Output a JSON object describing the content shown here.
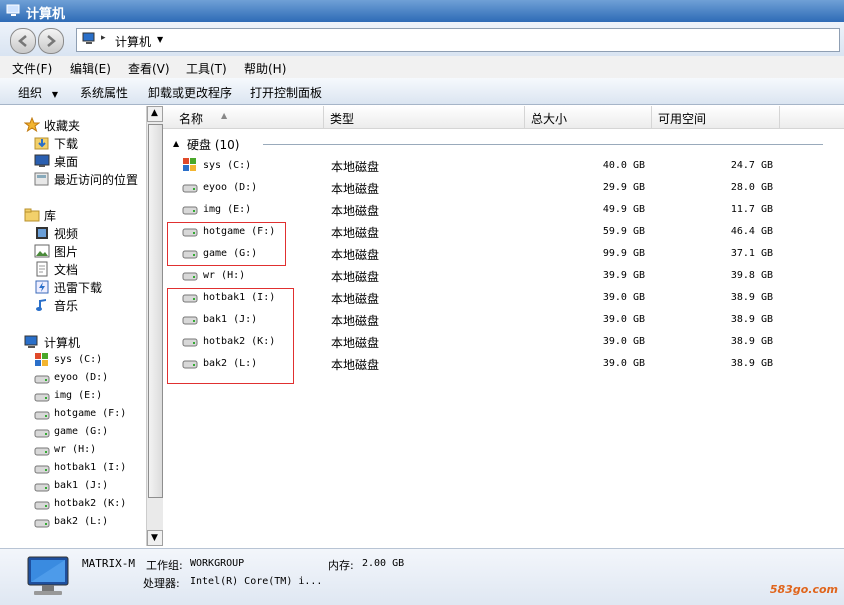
{
  "window": {
    "title": "计算机"
  },
  "address": {
    "crumb": "计算机"
  },
  "menu": [
    "文件(F)",
    "编辑(E)",
    "查看(V)",
    "工具(T)",
    "帮助(H)"
  ],
  "commands": [
    "组织",
    "系统属性",
    "卸载或更改程序",
    "打开控制面板"
  ],
  "nav": {
    "favorites": {
      "label": "收藏夹",
      "items": [
        "下载",
        "桌面",
        "最近访问的位置"
      ]
    },
    "libraries": {
      "label": "库",
      "items": [
        "视频",
        "图片",
        "文档",
        "迅雷下载",
        "音乐"
      ]
    },
    "computer": {
      "label": "计算机",
      "drives": [
        "sys (C:)",
        "eyoo (D:)",
        "img (E:)",
        "hotgame (F:)",
        "game (G:)",
        "wr (H:)",
        "hotbak1 (I:)",
        "bak1 (J:)",
        "hotbak2 (K:)",
        "bak2 (L:)"
      ]
    }
  },
  "columns": [
    "名称",
    "类型",
    "总大小",
    "可用空间"
  ],
  "group": {
    "label": "硬盘 (10)"
  },
  "drives": [
    {
      "name": "sys (C:)",
      "type": "本地磁盘",
      "total": "40.0 GB",
      "free": "24.7 GB",
      "icon": "windows-drive-icon"
    },
    {
      "name": "eyoo (D:)",
      "type": "本地磁盘",
      "total": "29.9 GB",
      "free": "28.0 GB",
      "icon": "drive-icon"
    },
    {
      "name": "img (E:)",
      "type": "本地磁盘",
      "total": "49.9 GB",
      "free": "11.7 GB",
      "icon": "drive-icon"
    },
    {
      "name": "hotgame (F:)",
      "type": "本地磁盘",
      "total": "59.9 GB",
      "free": "46.4 GB",
      "icon": "drive-icon"
    },
    {
      "name": "game (G:)",
      "type": "本地磁盘",
      "total": "99.9 GB",
      "free": "37.1 GB",
      "icon": "drive-icon"
    },
    {
      "name": "wr (H:)",
      "type": "本地磁盘",
      "total": "39.9 GB",
      "free": "39.8 GB",
      "icon": "drive-icon"
    },
    {
      "name": "hotbak1 (I:)",
      "type": "本地磁盘",
      "total": "39.0 GB",
      "free": "38.9 GB",
      "icon": "drive-icon"
    },
    {
      "name": "bak1 (J:)",
      "type": "本地磁盘",
      "total": "39.0 GB",
      "free": "38.9 GB",
      "icon": "drive-icon"
    },
    {
      "name": "hotbak2 (K:)",
      "type": "本地磁盘",
      "total": "39.0 GB",
      "free": "38.9 GB",
      "icon": "drive-icon"
    },
    {
      "name": "bak2 (L:)",
      "type": "本地磁盘",
      "total": "39.0 GB",
      "free": "38.9 GB",
      "icon": "drive-icon"
    }
  ],
  "details": {
    "computer_name": "MATRIX-M",
    "workgroup_label": "工作组:",
    "workgroup": "WORKGROUP",
    "memory_label": "内存:",
    "memory": "2.00 GB",
    "cpu_label": "处理器:",
    "cpu": "Intel(R) Core(TM) i..."
  },
  "watermark": "583go.com",
  "colors": {
    "highlight_box": "#e03030",
    "titlebar": "#2e6bb6",
    "watermark": "#e0651c"
  }
}
